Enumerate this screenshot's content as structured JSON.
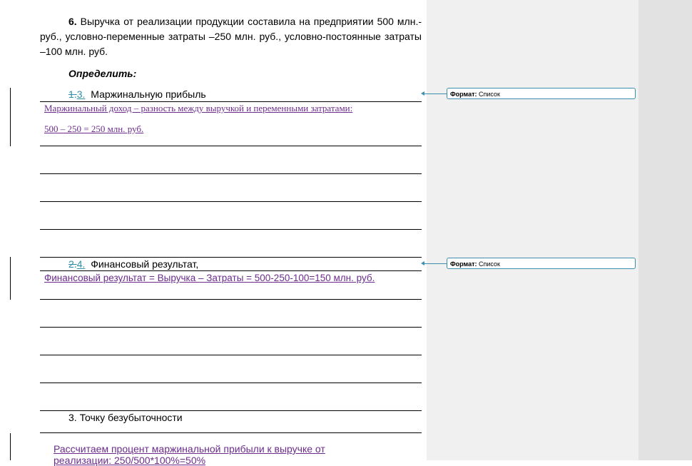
{
  "problem": {
    "number": "6.",
    "text": " Выручка от реализации продукции составила на предприятии 500 млн.- руб., условно-переменные затраты –250 млн. руб., условно-постоянные затраты –100 млн. руб."
  },
  "determine_label": "Определить:",
  "items": [
    {
      "deleted_num": "1.",
      "inserted_num": "3.",
      "label": "Маржинальную прибыль",
      "answer_lines": [
        "Маржинальный доход – разность между выручкой и переменными затратами:",
        "500 – 250 = 250 млн. руб."
      ]
    },
    {
      "deleted_num": "2.",
      "inserted_num": "4.",
      "label": "Финансовый результат,",
      "answer_lines": [
        "Финансовый результат = Выручка – Затраты = 500-250-100=150 млн. руб."
      ]
    },
    {
      "num": "3.",
      "label": "Точку безубыточности",
      "answer_lines": [
        "Рассчитаем процент маржинальной прибыли к выручке от",
        "реализации: 250/500*100%=50%"
      ]
    }
  ],
  "balloons": [
    {
      "label": "Формат:",
      "value": "Список"
    },
    {
      "label": "Формат:",
      "value": "Список"
    }
  ],
  "colors": {
    "inserted_text": "#6b2c8c",
    "revision_number": "#2e8fa8",
    "balloon_border": "#3d8fb0",
    "markup_pane": "#f0f0f0"
  }
}
